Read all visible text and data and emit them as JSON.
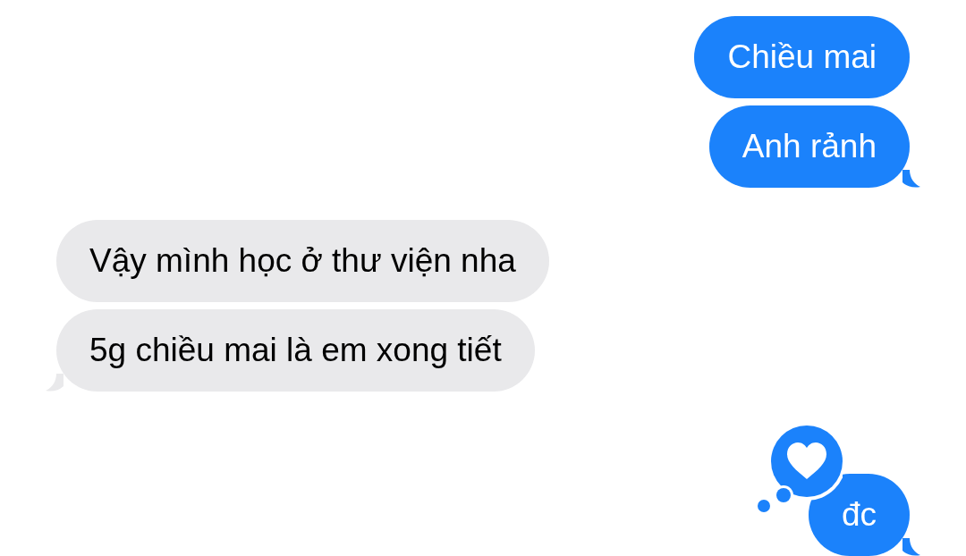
{
  "messages": [
    {
      "text": "Chiều mai",
      "kind": "sent",
      "tail": false
    },
    {
      "text": "Anh rảnh",
      "kind": "sent",
      "tail": true
    },
    {
      "text": "Vậy mình học ở thư viện nha",
      "kind": "received",
      "tail": false
    },
    {
      "text": "5g chiều mai là em xong tiết",
      "kind": "received",
      "tail": true
    },
    {
      "text": "đc",
      "kind": "sent",
      "tail": true,
      "reaction": {
        "kind": "heart"
      }
    }
  ]
}
